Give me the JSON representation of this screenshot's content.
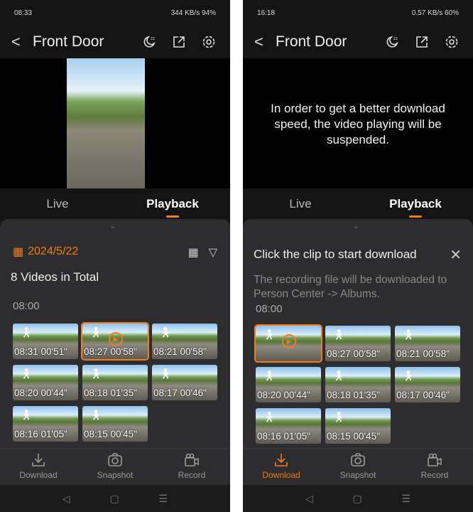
{
  "accent": "#f07d1a",
  "left": {
    "status": {
      "time": "08:33",
      "right": "344 KB/s  94%"
    },
    "header": {
      "title": "Front Door",
      "icons": [
        "chevron-left-icon",
        "sleep-moon-icon",
        "share-icon",
        "gear-icon"
      ]
    },
    "tabs": [
      "Live",
      "Playback"
    ],
    "date": "2024/5/22",
    "count": "8 Videos in Total",
    "hour": "08:00",
    "clips": [
      "08:31 00'51\"",
      "08:27 00'58\"",
      "08:21 00'58\"",
      "08:20 00'44\"",
      "08:18 01'35\"",
      "08:17 00'46\"",
      "08:16 01'05\"",
      "08:15 00'45\""
    ],
    "selected": 1,
    "bottom": [
      "Download",
      "Snapshot",
      "Record"
    ]
  },
  "right": {
    "status": {
      "time": "16:18",
      "right": "0.57 KB/s  60%"
    },
    "header": {
      "title": "Front Door"
    },
    "overlay": "In order to get a better download speed, the video playing will be suspended.",
    "tabs": [
      "Live",
      "Playback"
    ],
    "dl_title": "Click the clip to start download",
    "dl_desc": "The recording file will be downloaded to Person Center -> Albums.",
    "hour": "08:00",
    "clips": [
      "",
      "08:27 00'58\"",
      "08:21 00'58\"",
      "08:20 00'44\"",
      "08:18 01'35\"",
      "08:17 00'46\"",
      "08:16 01'05\"",
      "08:15 00'45\""
    ],
    "selected": 0,
    "bottom": [
      "Download",
      "Snapshot",
      "Record"
    ],
    "active_bottom": "Download"
  }
}
